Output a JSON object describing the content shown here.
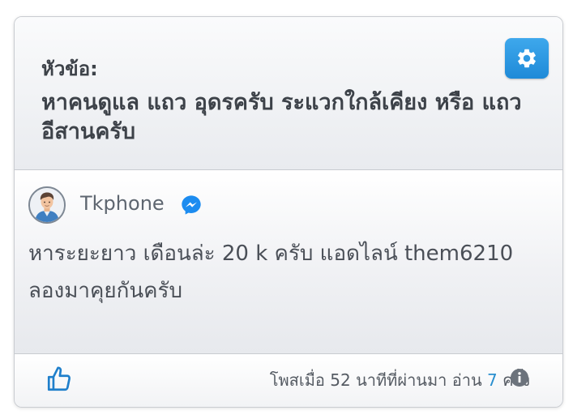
{
  "topic": {
    "label": "หัวข้อ:",
    "title": "หาคนดูแล แถว อุดรครับ ระแวกใกล้เคียง หรือ แถวอีสานครับ"
  },
  "settings_icon": "gear-icon",
  "post": {
    "author": "Tkphone",
    "author_badge_icon": "messenger-icon",
    "avatar_icon": "user-avatar",
    "message": "หาระยะยาว เดือนล่ะ 20 k ครับ แอดไลน์ them6210 ลองมาคุยกันครับ"
  },
  "footer": {
    "like_icon": "thumbs-up-icon",
    "posted_prefix": "โพสเมื่อ 52 นาทีที่ผ่านมา อ่าน",
    "read_count": "7",
    "read_suffix": "ครั้ง",
    "info_icon": "info-icon"
  },
  "colors": {
    "accent": "#2a8fcf",
    "settings_button": "#2b97e0",
    "messenger": "#1c8cf0",
    "text": "#3d4249"
  }
}
